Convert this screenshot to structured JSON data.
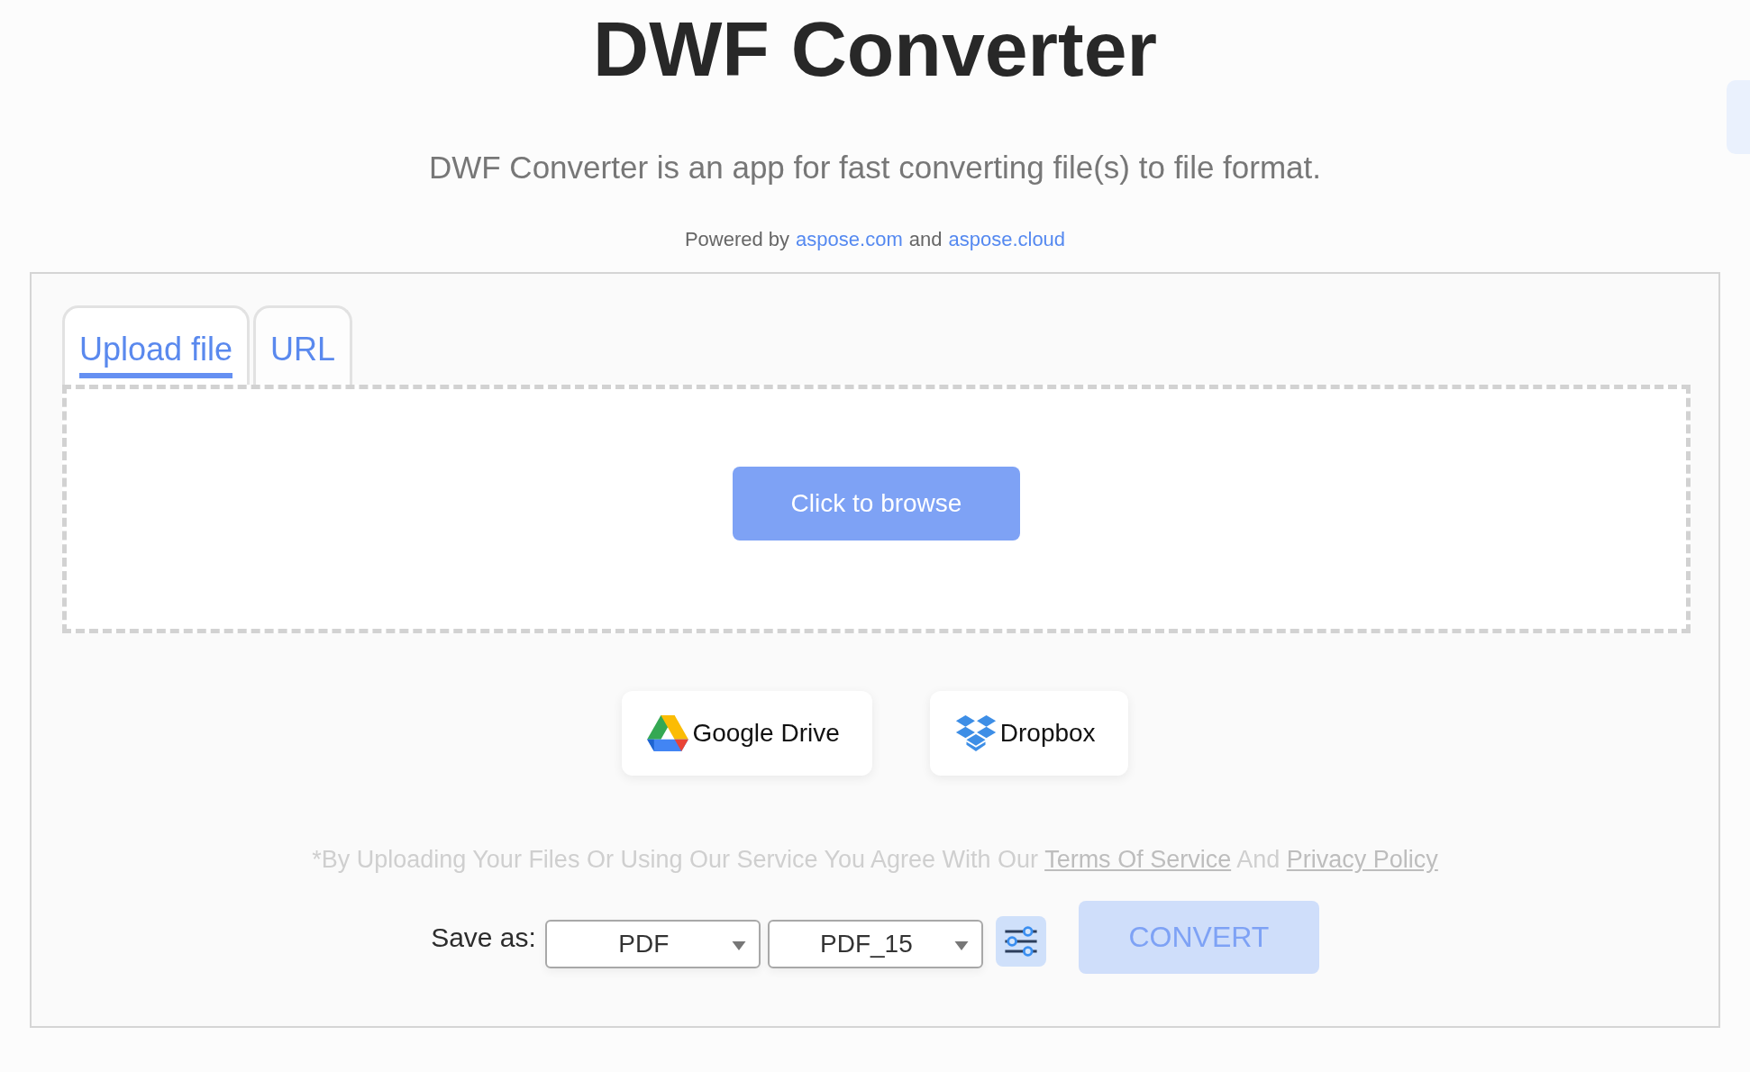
{
  "title": "DWF Converter",
  "subtitle": "DWF Converter is an app for fast converting file(s) to file format.",
  "powered_by": {
    "text": "Powered by",
    "links": [
      "aspose.com",
      "aspose.cloud"
    ],
    "joiner": "and"
  },
  "tabs": [
    {
      "label": "Upload file",
      "selected": true
    },
    {
      "label": "URL",
      "selected": false
    }
  ],
  "browse_button": "Click to browse",
  "cloud_buttons": [
    {
      "kind": "gdrive",
      "label": "Google Drive"
    },
    {
      "kind": "dropbox",
      "label": "Dropbox"
    }
  ],
  "terms": {
    "text": "*By Uploading Your Files Or Using Our Service You Agree With Our",
    "link1": "Terms Of Service",
    "joiner": "And",
    "link2": "Privacy Policy"
  },
  "save_as": {
    "label": "Save as:",
    "format": "PDF",
    "version": "PDF_15"
  },
  "convert_button": {
    "label": "CONVERT",
    "disabled": true
  }
}
